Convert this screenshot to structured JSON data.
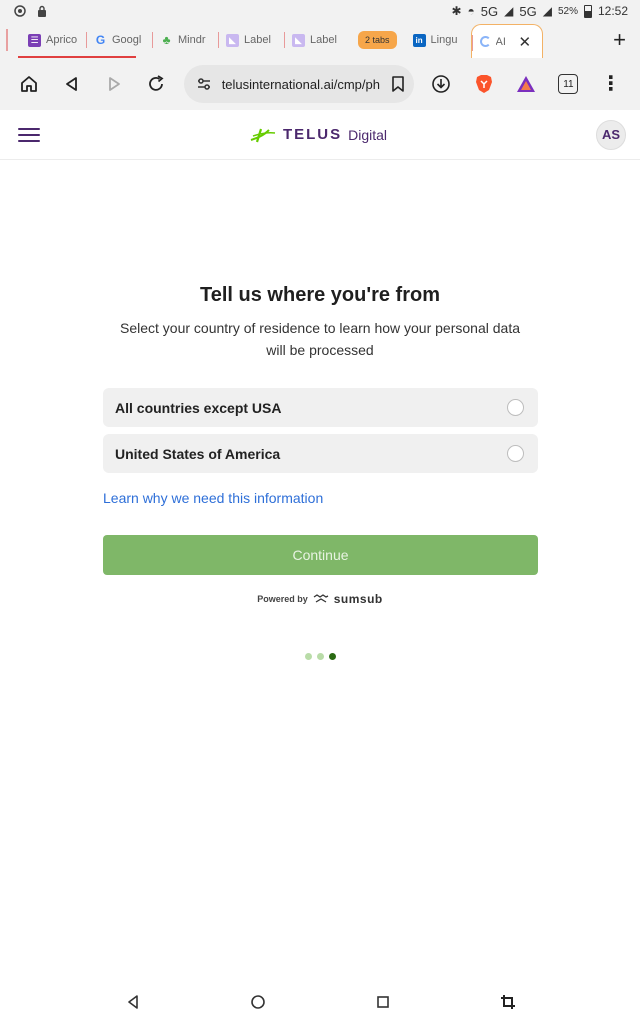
{
  "status_bar": {
    "network1": "5G",
    "network2": "5G",
    "battery": "52%",
    "time": "12:52"
  },
  "tabs": [
    {
      "label": "Aprico",
      "favicon_color": "#7b3fb5",
      "favicon_char": "☰"
    },
    {
      "label": "Googl",
      "favicon_color": "#ffffff",
      "favicon_char": "G"
    },
    {
      "label": "Mindr",
      "favicon_color": "#ffffff",
      "favicon_char": "♣"
    },
    {
      "label": "Label",
      "favicon_color": "#c9b8f0",
      "favicon_char": "L"
    },
    {
      "label": "Label",
      "favicon_color": "#c9b8f0",
      "favicon_char": "L"
    }
  ],
  "tab_group_label": "2 tabs",
  "linkedin_tab": {
    "label": "Lingu",
    "favicon_char": "in"
  },
  "active_tab": {
    "label": "AI"
  },
  "toolbar": {
    "url": "telusinternational.ai/cmp/ph",
    "tab_count": "11"
  },
  "header": {
    "logo_word": "TELUS",
    "logo_sub": "Digital",
    "avatar_initials": "AS"
  },
  "main": {
    "title": "Tell us where you're from",
    "subtitle": "Select your country of residence to learn how your personal data will be processed",
    "options": [
      {
        "label": "All countries except USA"
      },
      {
        "label": "United States of America"
      }
    ],
    "learn_link": "Learn why we need this information",
    "continue_label": "Continue",
    "powered_by": "Powered by",
    "powered_brand": "sumsub",
    "progress_step": 3,
    "progress_total": 3
  },
  "colors": {
    "brand_purple": "#4b286d",
    "brand_green": "#66cc00",
    "continue_green": "#7fb768",
    "link_blue": "#2e6fd8",
    "tab_group_orange": "#f6a64a"
  }
}
